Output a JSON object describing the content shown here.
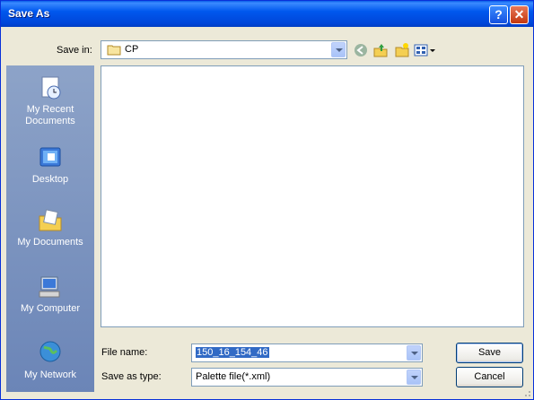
{
  "window": {
    "title": "Save As",
    "help_label": "?",
    "close_label": "✕"
  },
  "top": {
    "save_in_label": "Save in:",
    "save_in_value": "CP",
    "toolbar_icons": [
      "back-icon",
      "up-folder-icon",
      "new-folder-icon",
      "views-menu-icon"
    ]
  },
  "places": [
    {
      "label": "My Recent Documents",
      "icon": "recent-documents-icon"
    },
    {
      "label": "Desktop",
      "icon": "desktop-icon"
    },
    {
      "label": "My Documents",
      "icon": "my-documents-icon"
    },
    {
      "label": "My Computer",
      "icon": "my-computer-icon"
    },
    {
      "label": "My Network",
      "icon": "my-network-icon"
    }
  ],
  "bottom": {
    "file_name_label": "File name:",
    "file_name_value": "150_16_154_46",
    "save_as_type_label": "Save as type:",
    "save_as_type_value": "Palette file(*.xml)",
    "save_button": "Save",
    "cancel_button": "Cancel"
  },
  "colors": {
    "titlebar": "#0058EE",
    "selection": "#316AC5",
    "face": "#ECE9D8"
  }
}
